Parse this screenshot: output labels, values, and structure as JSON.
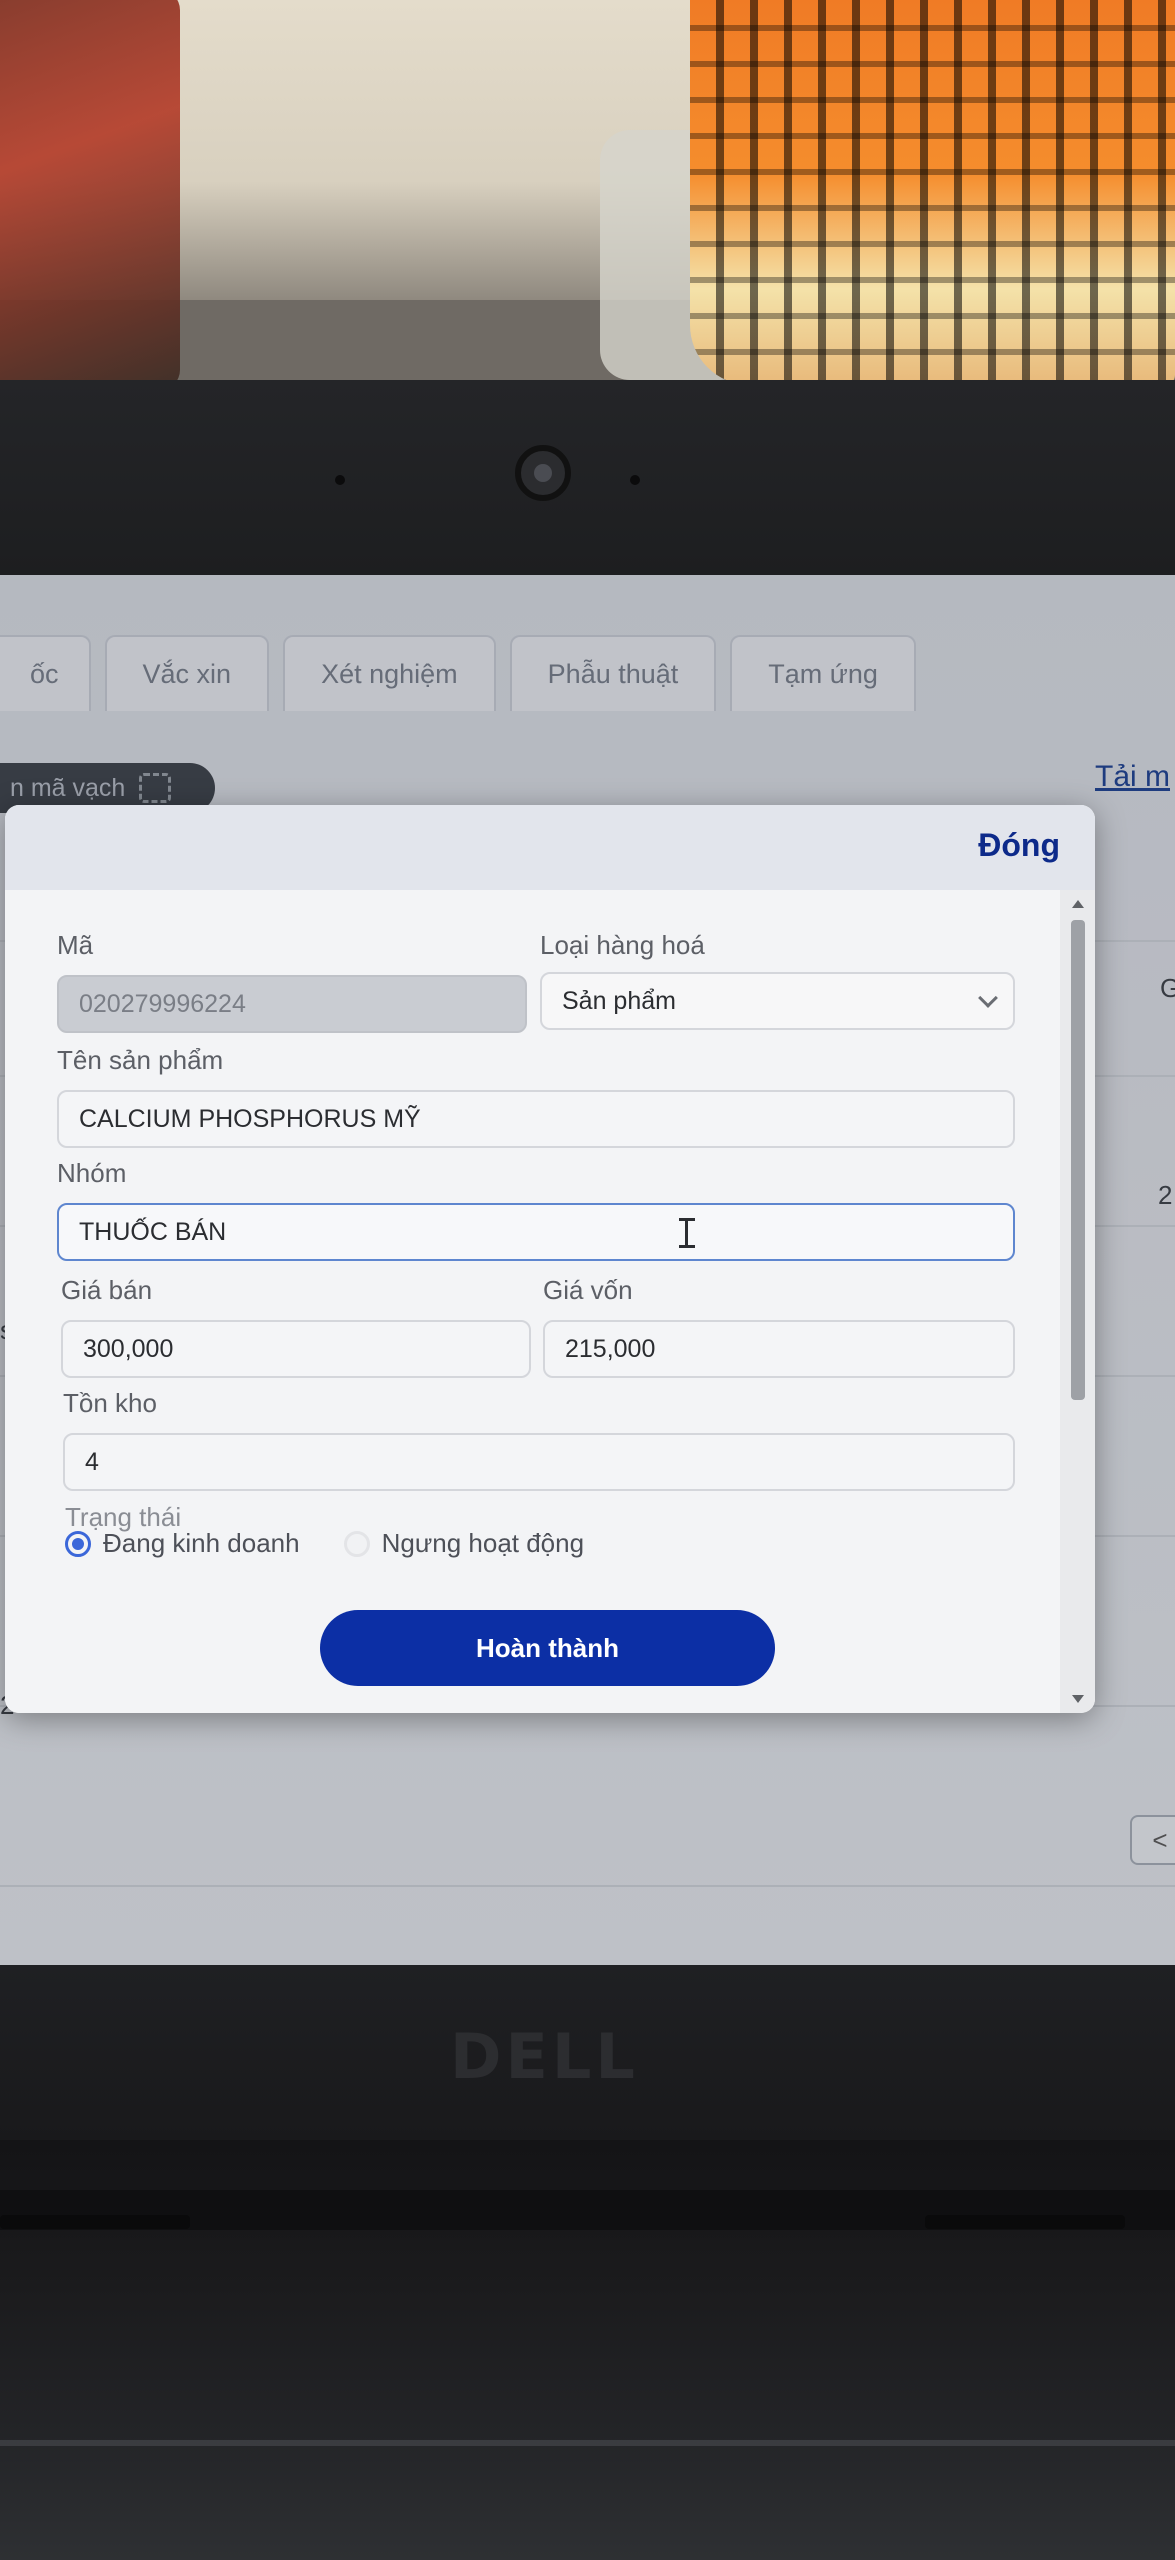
{
  "background_tabs": [
    "ốc",
    "Vắc xin",
    "Xét nghiệm",
    "Phẫu thuật",
    "Tạm ứng"
  ],
  "scan_label": "n mã vạch",
  "download_link": "Tải m",
  "edge_numbers": {
    "right_a": "G",
    "right_b": "2",
    "left_a": "s",
    "left_b": "2"
  },
  "pager_prev": "<",
  "brand": "DELL",
  "modal": {
    "close_label": "Đóng",
    "fields": {
      "code_label": "Mã",
      "code_value": "020279996224",
      "type_label": "Loại hàng hoá",
      "type_value": "Sản phẩm",
      "name_label": "Tên sản phẩm",
      "name_value": "CALCIUM PHOSPHORUS MỸ",
      "group_label": "Nhóm",
      "group_value": "THUỐC BÁN",
      "price_label": "Giá bán",
      "price_value": "300,000",
      "cost_label": "Giá vốn",
      "cost_value": "215,000",
      "stock_label": "Tồn kho",
      "stock_value": "4",
      "status_label": "Trạng thái",
      "status_active": "Đang kinh doanh",
      "status_inactive": "Ngưng hoạt động"
    },
    "submit_label": "Hoàn thành"
  },
  "colors": {
    "primary": "#0c2fa5",
    "close_text": "#0d2a8a",
    "radio_accent": "#3b67d9"
  },
  "icons": {
    "close": "none",
    "select": "chevron-down-icon",
    "scan": "barcode-scan-icon",
    "cursor": "text-cursor-icon"
  }
}
